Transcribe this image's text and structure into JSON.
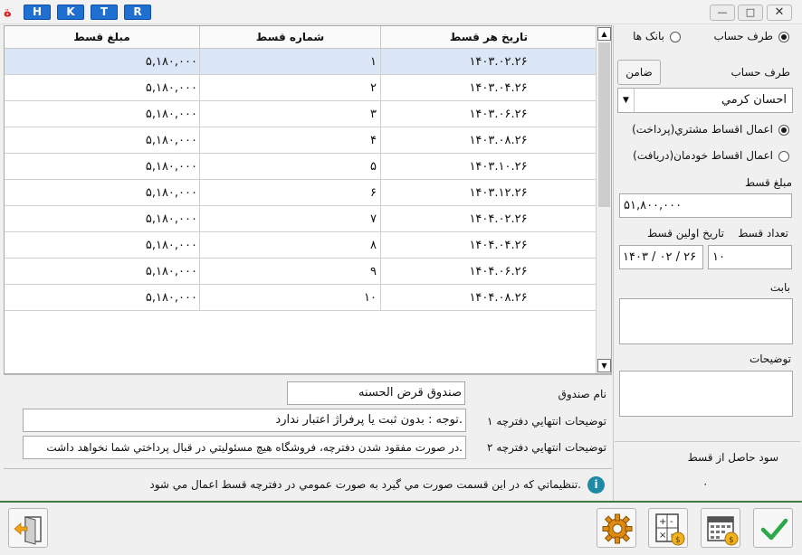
{
  "titlebar": {
    "logo": "ة",
    "buttons": [
      "H",
      "K",
      "T",
      "R"
    ]
  },
  "grid": {
    "headers": {
      "amount": "مبلغ قسط",
      "number": "شماره قسط",
      "date": "تاريخ هر قسط"
    },
    "rows": [
      {
        "amount": "۵,۱۸۰,۰۰۰",
        "number": "۱",
        "date": "۱۴۰۳.۰۲.۲۶"
      },
      {
        "amount": "۵,۱۸۰,۰۰۰",
        "number": "۲",
        "date": "۱۴۰۳.۰۴.۲۶"
      },
      {
        "amount": "۵,۱۸۰,۰۰۰",
        "number": "۳",
        "date": "۱۴۰۳.۰۶.۲۶"
      },
      {
        "amount": "۵,۱۸۰,۰۰۰",
        "number": "۴",
        "date": "۱۴۰۳.۰۸.۲۶"
      },
      {
        "amount": "۵,۱۸۰,۰۰۰",
        "number": "۵",
        "date": "۱۴۰۳.۱۰.۲۶"
      },
      {
        "amount": "۵,۱۸۰,۰۰۰",
        "number": "۶",
        "date": "۱۴۰۳.۱۲.۲۶"
      },
      {
        "amount": "۵,۱۸۰,۰۰۰",
        "number": "۷",
        "date": "۱۴۰۴.۰۲.۲۶"
      },
      {
        "amount": "۵,۱۸۰,۰۰۰",
        "number": "۸",
        "date": "۱۴۰۴.۰۴.۲۶"
      },
      {
        "amount": "۵,۱۸۰,۰۰۰",
        "number": "۹",
        "date": "۱۴۰۴.۰۶.۲۶"
      },
      {
        "amount": "۵,۱۸۰,۰۰۰",
        "number": "۱۰",
        "date": "۱۴۰۴.۰۸.۲۶"
      }
    ]
  },
  "right": {
    "radio_account": "طرف حساب",
    "radio_banks": "بانک ها",
    "account_label": "طرف حساب",
    "guarantor_button": "ضامن",
    "account_value": "احسان کرمي",
    "radio_customer": "اعمال اقساط مشتري(پرداخت)",
    "radio_own": "اعمال اقساط خودمان(دريافت)",
    "amount_label": "مبلغ قسط",
    "amount_value": "۵۱,۸۰۰,۰۰۰",
    "count_label": "تعداد قسط",
    "first_date_label": "تاريخ اولين قسط",
    "count_value": "۱۰",
    "first_date_value": "۱۴۰۳ / ۰۲ / ۲۶",
    "bābat_label": "بابت",
    "desc_label": "توضيحات",
    "profit_label": "سود حاصل از قسط",
    "profit_value": "۰"
  },
  "notes": {
    "fund_label": "نام صندوق",
    "fund_value": "صندوق قرض الحسنه",
    "note1_label": "توضيحات انتهايي دفترچه ۱",
    "note1_value": "توجه : بدون ثبت يا پرفراژ اعتبار ندارد.",
    "note2_label": "توضيحات انتهايي دفترچه ۲",
    "note2_value": "در صورت مفقود شدن دفترچه، فروشگاه هيچ مسئوليتي در قبال پرداختي شما نخواهد داشت.",
    "info_text": "تنظيماتي که در اين قسمت صورت مي گيرد به صورت عمومي در دفترچه قسط اعمال مي شود."
  },
  "colors": {
    "accent": "#1f6fd0",
    "selected_row": "#dbe6f7",
    "footer_line": "#3d7a3d",
    "ok_green": "#2aa84a",
    "gear_orange": "#e08a10"
  }
}
